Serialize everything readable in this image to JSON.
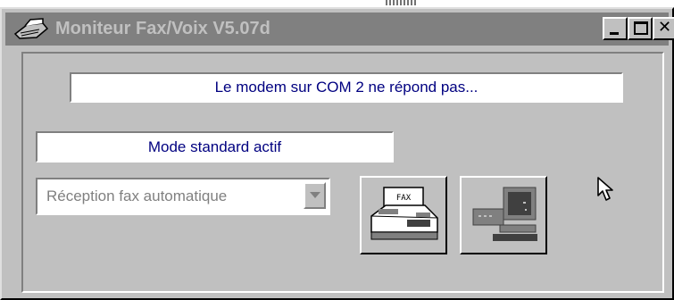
{
  "window": {
    "title": "Moniteur Fax/Voix V5.07d",
    "controls": [
      "minimize",
      "maximize",
      "close"
    ]
  },
  "status": {
    "modem_message": "Le modem sur COM 2 ne répond pas...",
    "mode_message": "Mode standard actif"
  },
  "reception_mode": {
    "selected": "Réception fax automatique",
    "enabled": false
  },
  "buttons": {
    "fax_icon_label": "FAX",
    "fax_icon": "fax-machine-icon",
    "computer_icon": "computer-icon"
  },
  "colors": {
    "title_bar": "#808080",
    "window_face": "#c0c0c0",
    "status_text": "#000080"
  }
}
